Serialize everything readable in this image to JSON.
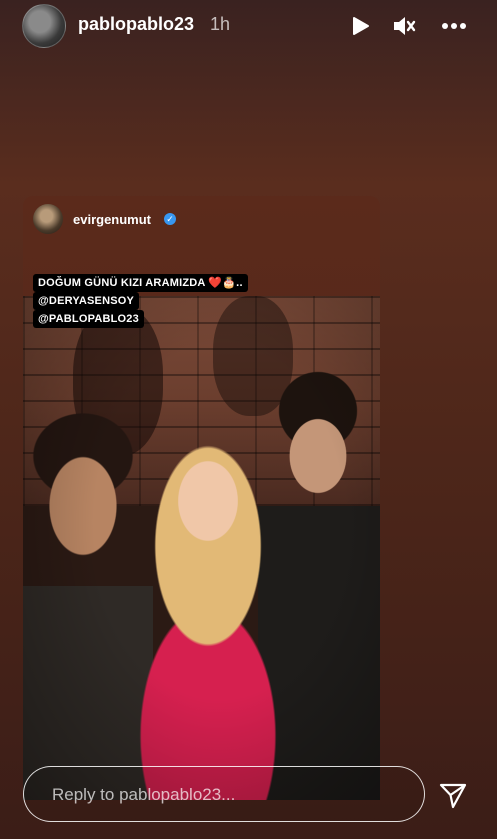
{
  "story": {
    "username": "pablopablo23",
    "time": "1h"
  },
  "reshare": {
    "username": "evirgenumut",
    "caption_lines": [
      "DOĞUM GÜNÜ KIZI ARAMIZDA ❤️🎂..",
      "@DERYASENSOY",
      "@PABLOPABLO23"
    ]
  },
  "reply": {
    "placeholder": "Reply to pablopablo23..."
  },
  "icons": {
    "play": "play-icon",
    "mute": "muted-speaker-icon",
    "more": "more-horizontal-icon",
    "verified": "verified-badge-icon",
    "send": "send-icon"
  }
}
